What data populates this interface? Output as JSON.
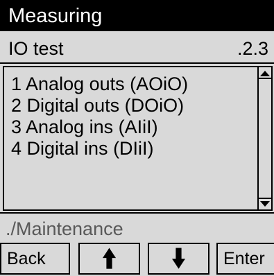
{
  "title": "Measuring",
  "header": {
    "title": "IO test",
    "index": ".2.3"
  },
  "menu": {
    "items": [
      {
        "label": "1 Analog outs (AOiO)"
      },
      {
        "label": "2 Digital outs (DOiO)"
      },
      {
        "label": "3 Analog ins (AIiI)"
      },
      {
        "label": "4 Digital ins (DIiI)"
      }
    ]
  },
  "status": {
    "path": "./Maintenance"
  },
  "softkeys": {
    "back_label": "Back",
    "up_icon": "arrow-up-icon",
    "down_icon": "arrow-down-icon",
    "enter_label": "Enter"
  },
  "colors": {
    "screen_background": "#d9d9d9",
    "title_bar": "#000000",
    "status_text": "#595959"
  }
}
